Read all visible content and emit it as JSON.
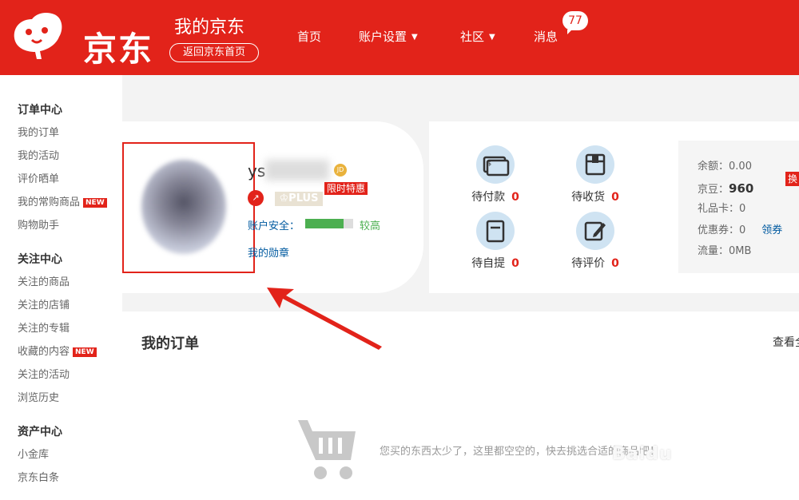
{
  "header": {
    "logo_text": "京东",
    "title": "我的京东",
    "back_home": "返回京东首页",
    "nav": [
      {
        "label": "首页"
      },
      {
        "label": "账户设置"
      },
      {
        "label": "社区"
      },
      {
        "label": "消息"
      }
    ],
    "message_count": "77"
  },
  "sidebar": {
    "groups": [
      {
        "title": "订单中心",
        "items": [
          "我的订单",
          "我的活动",
          "评价晒单",
          "我的常购商品",
          "购物助手"
        ]
      },
      {
        "title": "关注中心",
        "items": [
          "关注的商品",
          "关注的店铺",
          "关注的专辑",
          "收藏的内容",
          "关注的活动",
          "浏览历史"
        ]
      },
      {
        "title": "资产中心",
        "items": [
          "小金库",
          "京东白条"
        ]
      }
    ],
    "new_badge": "NEW"
  },
  "user": {
    "username": "ys",
    "level_icon": "JD",
    "plus": "♔PLUS",
    "promo": "限时特惠",
    "security_label": "账户安全：",
    "security_level": "较高",
    "security_progress": 0.8,
    "medal_link": "我的勋章"
  },
  "status": [
    {
      "label": "待付款",
      "count": "0",
      "icon": "wallet-card-icon"
    },
    {
      "label": "待收货",
      "count": "0",
      "icon": "package-box-icon"
    },
    {
      "label": "待自提",
      "count": "0",
      "icon": "pickup-bag-icon"
    },
    {
      "label": "待评价",
      "count": "0",
      "icon": "edit-review-icon"
    }
  ],
  "assets": {
    "balance_label": "余额：",
    "balance": "0.00",
    "beans_label": "京豆：",
    "beans": "960",
    "exchange": "换",
    "giftcard_label": "礼品卡：",
    "giftcard": "0",
    "coupon_label": "优惠券：",
    "coupon": "0",
    "coupon_link": "领券",
    "traffic_label": "流量：",
    "traffic": "0MB"
  },
  "orders": {
    "title": "我的订单",
    "view_all": "查看全",
    "empty_message": "您买的东西太少了，这里都空空的，快去挑选合适的商品吧！"
  },
  "watermark": "Baidu",
  "colors": {
    "brand": "#e2231a",
    "link": "#005aa0",
    "icon_bg": "#cfe3f2",
    "secure": "#4caf50"
  }
}
